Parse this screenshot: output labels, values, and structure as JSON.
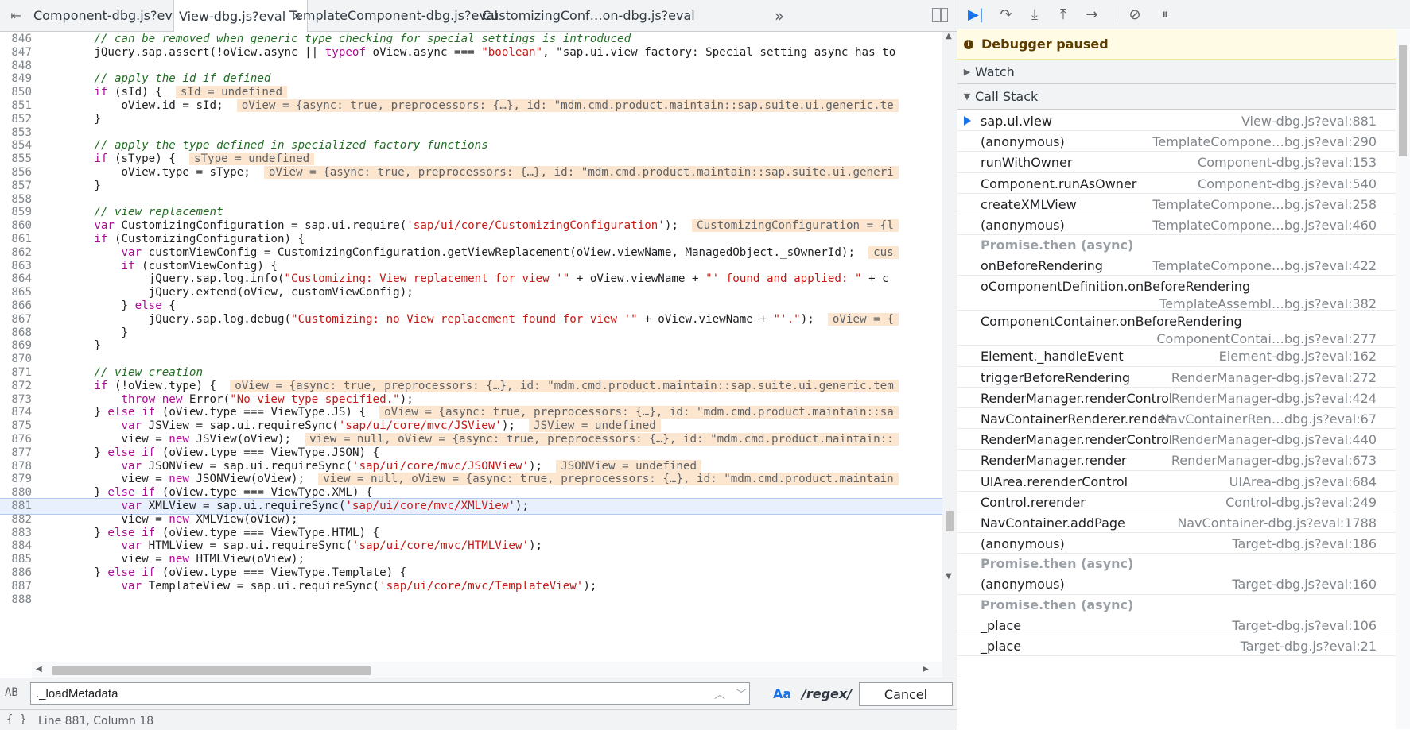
{
  "editor_tabs": [
    {
      "label": "Component-dbg.js?eval",
      "active": false
    },
    {
      "label": "View-dbg.js?eval",
      "active": true
    },
    {
      "label": "TemplateComponent-dbg.js?eval",
      "active": false
    },
    {
      "label": "CustomizingConf…on-dbg.js?eval",
      "active": false
    }
  ],
  "more_tabs_label": "»",
  "close_glyph": "×",
  "code_lines": [
    {
      "n": "846",
      "t": "        // can be removed when generic type checking for special settings is introduced"
    },
    {
      "n": "847",
      "t": "        jQuery.sap.assert(!oView.async || typeof oView.async === \"boolean\", \"sap.ui.view factory: Special setting async has to"
    },
    {
      "n": "848",
      "t": ""
    },
    {
      "n": "849",
      "t": "        // apply the id if defined"
    },
    {
      "n": "850",
      "t": "        if (sId) {",
      "inline": "sId = undefined"
    },
    {
      "n": "851",
      "t": "            oView.id = sId;",
      "inline": "oView = {async: true, preprocessors: {…}, id: \"mdm.cmd.product.maintain::sap.suite.ui.generic.te"
    },
    {
      "n": "852",
      "t": "        }"
    },
    {
      "n": "853",
      "t": ""
    },
    {
      "n": "854",
      "t": "        // apply the type defined in specialized factory functions"
    },
    {
      "n": "855",
      "t": "        if (sType) {",
      "inline": "sType = undefined"
    },
    {
      "n": "856",
      "t": "            oView.type = sType;",
      "inline": "oView = {async: true, preprocessors: {…}, id: \"mdm.cmd.product.maintain::sap.suite.ui.generi"
    },
    {
      "n": "857",
      "t": "        }"
    },
    {
      "n": "858",
      "t": ""
    },
    {
      "n": "859",
      "t": "        // view replacement"
    },
    {
      "n": "860",
      "t": "        var CustomizingConfiguration = sap.ui.require('sap/ui/core/CustomizingConfiguration');",
      "inline": "CustomizingConfiguration = {l"
    },
    {
      "n": "861",
      "t": "        if (CustomizingConfiguration) {"
    },
    {
      "n": "862",
      "t": "            var customViewConfig = CustomizingConfiguration.getViewReplacement(oView.viewName, ManagedObject._sOwnerId);",
      "inline": "cus"
    },
    {
      "n": "863",
      "t": "            if (customViewConfig) {"
    },
    {
      "n": "864",
      "t": "                jQuery.sap.log.info(\"Customizing: View replacement for view '\" + oView.viewName + \"' found and applied: \" + c"
    },
    {
      "n": "865",
      "t": "                jQuery.extend(oView, customViewConfig);"
    },
    {
      "n": "866",
      "t": "            } else {"
    },
    {
      "n": "867",
      "t": "                jQuery.sap.log.debug(\"Customizing: no View replacement found for view '\" + oView.viewName + \"'.\");",
      "inline": "oView = {"
    },
    {
      "n": "868",
      "t": "            }"
    },
    {
      "n": "869",
      "t": "        }"
    },
    {
      "n": "870",
      "t": ""
    },
    {
      "n": "871",
      "t": "        // view creation"
    },
    {
      "n": "872",
      "t": "        if (!oView.type) {",
      "inline": "oView = {async: true, preprocessors: {…}, id: \"mdm.cmd.product.maintain::sap.suite.ui.generic.tem"
    },
    {
      "n": "873",
      "t": "            throw new Error(\"No view type specified.\");"
    },
    {
      "n": "874",
      "t": "        } else if (oView.type === ViewType.JS) {",
      "inline": "oView = {async: true, preprocessors: {…}, id: \"mdm.cmd.product.maintain::sa"
    },
    {
      "n": "875",
      "t": "            var JSView = sap.ui.requireSync('sap/ui/core/mvc/JSView');",
      "inline": "JSView = undefined"
    },
    {
      "n": "876",
      "t": "            view = new JSView(oView);",
      "inline": "view = null, oView = {async: true, preprocessors: {…}, id: \"mdm.cmd.product.maintain::"
    },
    {
      "n": "877",
      "t": "        } else if (oView.type === ViewType.JSON) {"
    },
    {
      "n": "878",
      "t": "            var JSONView = sap.ui.requireSync('sap/ui/core/mvc/JSONView');",
      "inline": "JSONView = undefined"
    },
    {
      "n": "879",
      "t": "            view = new JSONView(oView);",
      "inline": "view = null, oView = {async: true, preprocessors: {…}, id: \"mdm.cmd.product.maintain"
    },
    {
      "n": "880",
      "t": "        } else if (oView.type === ViewType.XML) {"
    },
    {
      "n": "881",
      "t": "            var XMLView = sap.ui.requireSync('sap/ui/core/mvc/XMLView');",
      "current": true
    },
    {
      "n": "882",
      "t": "            view = new XMLView(oView);"
    },
    {
      "n": "883",
      "t": "        } else if (oView.type === ViewType.HTML) {"
    },
    {
      "n": "884",
      "t": "            var HTMLView = sap.ui.requireSync('sap/ui/core/mvc/HTMLView');"
    },
    {
      "n": "885",
      "t": "            view = new HTMLView(oView);"
    },
    {
      "n": "886",
      "t": "        } else if (oView.type === ViewType.Template) {"
    },
    {
      "n": "887",
      "t": "            var TemplateView = sap.ui.requireSync('sap/ui/core/mvc/TemplateView');"
    },
    {
      "n": "888",
      "t": ""
    }
  ],
  "search": {
    "icon_text": "AB",
    "value": "._loadMetadata",
    "up": "︿",
    "down": "﹀",
    "match_case": "Aa",
    "regex": "/regex/",
    "cancel": "Cancel"
  },
  "status": {
    "braces": "{ }",
    "position": "Line 881, Column 18"
  },
  "debugger": {
    "paused_label": "Debugger paused",
    "paused_icon": "i",
    "watch_label": "Watch",
    "call_stack_label": "Call Stack",
    "frames": [
      {
        "kind": "frame",
        "fn": "sap.ui.view",
        "loc": "View-dbg.js?eval:881",
        "current": true
      },
      {
        "kind": "frame",
        "fn": "(anonymous)",
        "loc": "TemplateCompone…bg.js?eval:290"
      },
      {
        "kind": "frame",
        "fn": "runWithOwner",
        "loc": "Component-dbg.js?eval:153"
      },
      {
        "kind": "frame",
        "fn": "Component.runAsOwner",
        "loc": "Component-dbg.js?eval:540"
      },
      {
        "kind": "frame",
        "fn": "createXMLView",
        "loc": "TemplateCompone…bg.js?eval:258"
      },
      {
        "kind": "frame",
        "fn": "(anonymous)",
        "loc": "TemplateCompone…bg.js?eval:460"
      },
      {
        "kind": "async",
        "fn": "Promise.then (async)"
      },
      {
        "kind": "frame",
        "fn": "onBeforeRendering",
        "loc": "TemplateCompone…bg.js?eval:422"
      },
      {
        "kind": "frame2",
        "fn": "oComponentDefinition.onBeforeRendering",
        "loc": "TemplateAssembl…bg.js?eval:382"
      },
      {
        "kind": "frame2",
        "fn": "ComponentContainer.onBeforeRendering",
        "loc": "ComponentContai…bg.js?eval:277"
      },
      {
        "kind": "frame",
        "fn": "Element._handleEvent",
        "loc": "Element-dbg.js?eval:162"
      },
      {
        "kind": "frame",
        "fn": "triggerBeforeRendering",
        "loc": "RenderManager-dbg.js?eval:272"
      },
      {
        "kind": "frame",
        "fn": "RenderManager.renderControl",
        "loc": "RenderManager-dbg.js?eval:424"
      },
      {
        "kind": "frame",
        "fn": "NavContainerRenderer.render",
        "loc": "NavContainerRen…dbg.js?eval:67"
      },
      {
        "kind": "frame",
        "fn": "RenderManager.renderControl",
        "loc": "RenderManager-dbg.js?eval:440"
      },
      {
        "kind": "frame",
        "fn": "RenderManager.render",
        "loc": "RenderManager-dbg.js?eval:673"
      },
      {
        "kind": "frame",
        "fn": "UIArea.rerenderControl",
        "loc": "UIArea-dbg.js?eval:684"
      },
      {
        "kind": "frame",
        "fn": "Control.rerender",
        "loc": "Control-dbg.js?eval:249"
      },
      {
        "kind": "frame",
        "fn": "NavContainer.addPage",
        "loc": "NavContainer-dbg.js?eval:1788"
      },
      {
        "kind": "frame",
        "fn": "(anonymous)",
        "loc": "Target-dbg.js?eval:186"
      },
      {
        "kind": "async",
        "fn": "Promise.then (async)"
      },
      {
        "kind": "frame",
        "fn": "(anonymous)",
        "loc": "Target-dbg.js?eval:160"
      },
      {
        "kind": "async",
        "fn": "Promise.then (async)"
      },
      {
        "kind": "frame",
        "fn": "_place",
        "loc": "Target-dbg.js?eval:106"
      },
      {
        "kind": "frame",
        "fn": "_place",
        "loc": "Target-dbg.js?eval:21"
      }
    ]
  },
  "toolbar_icons": [
    "resume-icon",
    "step-over-icon",
    "step-into-icon",
    "step-out-icon",
    "step-icon",
    "deactivate-breakpoints-icon",
    "pause-on-exceptions-icon"
  ]
}
